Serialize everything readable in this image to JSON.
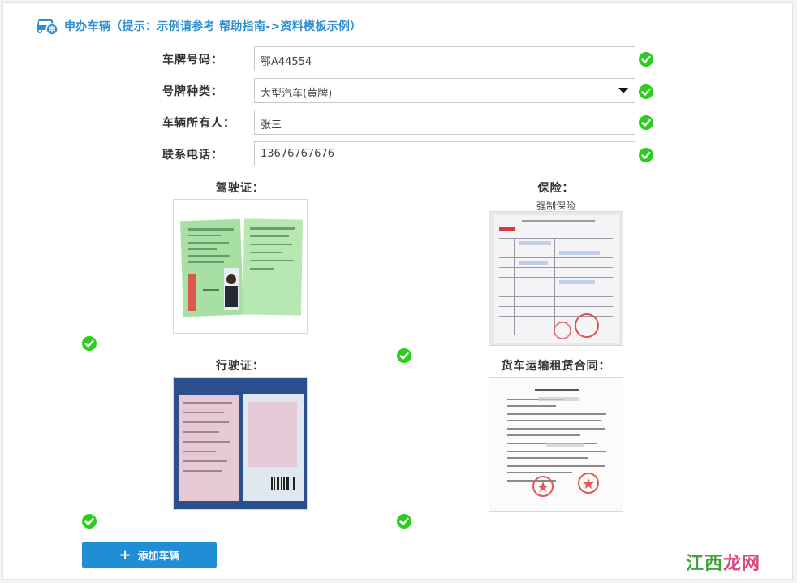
{
  "header": {
    "title": "申办车辆（提示：示例请参考 帮助指南->资料模板示例）"
  },
  "form": {
    "plate_number": {
      "label": "车牌号码：",
      "value": "鄂A44554"
    },
    "plate_type": {
      "label": "号牌种类：",
      "value": "大型汽车(黄牌)"
    },
    "owner": {
      "label": "车辆所有人：",
      "value": "张三"
    },
    "phone": {
      "label": "联系电话：",
      "value": "13676767676"
    }
  },
  "documents": {
    "driver_license": {
      "title": "驾驶证："
    },
    "insurance": {
      "title": "保险：",
      "subtitle": "强制保险"
    },
    "vehicle_license": {
      "title": "行驶证："
    },
    "lease_contract": {
      "title": "货车运输租赁合同："
    }
  },
  "actions": {
    "add_vehicle": "添加车辆"
  },
  "watermark": {
    "part1": "江西",
    "part2": "龙网"
  },
  "colors": {
    "accent": "#1f8ed6",
    "title_blue": "#2d8fd1",
    "check_green": "#2ecc20"
  }
}
